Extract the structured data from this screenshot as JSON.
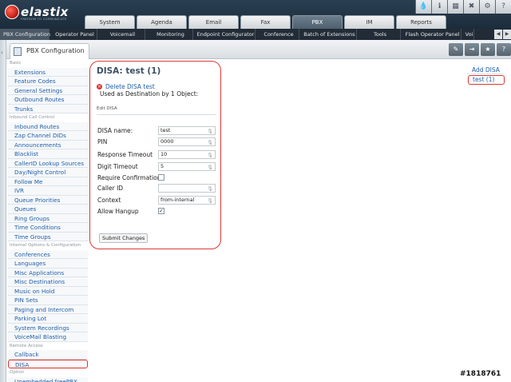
{
  "app": {
    "logo_text": "elastix",
    "logo_tagline": "FREEDOM TO COMMUNICATE"
  },
  "main_tabs": [
    {
      "label": "System"
    },
    {
      "label": "Agenda"
    },
    {
      "label": "Email"
    },
    {
      "label": "Fax"
    },
    {
      "label": "PBX",
      "active": true
    },
    {
      "label": "IM"
    },
    {
      "label": "Reports"
    }
  ],
  "top_icons": [
    "drop-icon",
    "info-icon",
    "grid-icon",
    "tools-icon",
    "settings-icon",
    "help-icon"
  ],
  "sub_nav": [
    {
      "label": "PBX Configuration",
      "active": true,
      "w": 62
    },
    {
      "label": "Operator Panel",
      "w": 60
    },
    {
      "label": "Voicemail",
      "w": 60
    },
    {
      "label": "Monitoring",
      "w": 60
    },
    {
      "label": "Endpoint Configurator",
      "w": 78
    },
    {
      "label": "Conference",
      "w": 55
    },
    {
      "label": "Batch of Extensions",
      "w": 72
    },
    {
      "label": "Tools",
      "w": 55
    },
    {
      "label": "Flash Operator Panel",
      "w": 76
    },
    {
      "label": "Voi",
      "w": 16
    }
  ],
  "module": {
    "tab_label": "PBX Configuration"
  },
  "sidebar": [
    {
      "type": "section",
      "label": "Basic"
    },
    {
      "type": "item",
      "label": "Extensions"
    },
    {
      "type": "item",
      "label": "Feature Codes"
    },
    {
      "type": "item",
      "label": "General Settings"
    },
    {
      "type": "item",
      "label": "Outbound Routes"
    },
    {
      "type": "item",
      "label": "Trunks"
    },
    {
      "type": "section",
      "label": "Inbound Call Control"
    },
    {
      "type": "item",
      "label": "Inbound Routes"
    },
    {
      "type": "item",
      "label": "Zap Channel DIDs"
    },
    {
      "type": "item",
      "label": "Announcements"
    },
    {
      "type": "item",
      "label": "Blacklist"
    },
    {
      "type": "item",
      "label": "CallerID Lookup Sources"
    },
    {
      "type": "item",
      "label": "Day/Night Control"
    },
    {
      "type": "item",
      "label": "Follow Me"
    },
    {
      "type": "item",
      "label": "IVR"
    },
    {
      "type": "item",
      "label": "Queue Priorities"
    },
    {
      "type": "item",
      "label": "Queues"
    },
    {
      "type": "item",
      "label": "Ring Groups"
    },
    {
      "type": "item",
      "label": "Time Conditions"
    },
    {
      "type": "item",
      "label": "Time Groups"
    },
    {
      "type": "section",
      "label": "Internal Options & Configuration"
    },
    {
      "type": "item",
      "label": "Conferences"
    },
    {
      "type": "item",
      "label": "Languages"
    },
    {
      "type": "item",
      "label": "Misc Applications"
    },
    {
      "type": "item",
      "label": "Misc Destinations"
    },
    {
      "type": "item",
      "label": "Music on Hold"
    },
    {
      "type": "item",
      "label": "PIN Sets"
    },
    {
      "type": "item",
      "label": "Paging and Intercom"
    },
    {
      "type": "item",
      "label": "Parking Lot"
    },
    {
      "type": "item",
      "label": "System Recordings"
    },
    {
      "type": "item",
      "label": "VoiceMail Blasting"
    },
    {
      "type": "section",
      "label": "Remote Access"
    },
    {
      "type": "item",
      "label": "Callback"
    },
    {
      "type": "item",
      "label": "DISA",
      "selected": true
    },
    {
      "type": "section",
      "label": "Option"
    },
    {
      "type": "item",
      "label": "Unembedded freePBX"
    }
  ],
  "form": {
    "title": "DISA: test (1)",
    "delete_link": "Delete DISA test",
    "used_as": "Used as Destination by 1 Object:",
    "section_label": "Edit DISA",
    "fields": [
      {
        "label": "DISA name:",
        "value": "test",
        "kind": "text"
      },
      {
        "label": "PIN",
        "value": "0000",
        "kind": "text"
      },
      {
        "label": "Response Timeout",
        "value": "10",
        "kind": "text"
      },
      {
        "label": "Digit Timeout",
        "value": "5",
        "kind": "text"
      },
      {
        "label": "Require Confirmation",
        "checked": false,
        "kind": "checkbox"
      },
      {
        "label": "Caller ID",
        "value": "",
        "kind": "text"
      },
      {
        "label": "Context",
        "value": "from-internal",
        "kind": "text"
      },
      {
        "label": "Allow Hangup",
        "checked": true,
        "kind": "checkbox"
      }
    ],
    "submit_label": "Submit Changes"
  },
  "right_panel": {
    "add_label": "Add DISA",
    "items": [
      "test (1)"
    ]
  },
  "watermark": "#1818761"
}
